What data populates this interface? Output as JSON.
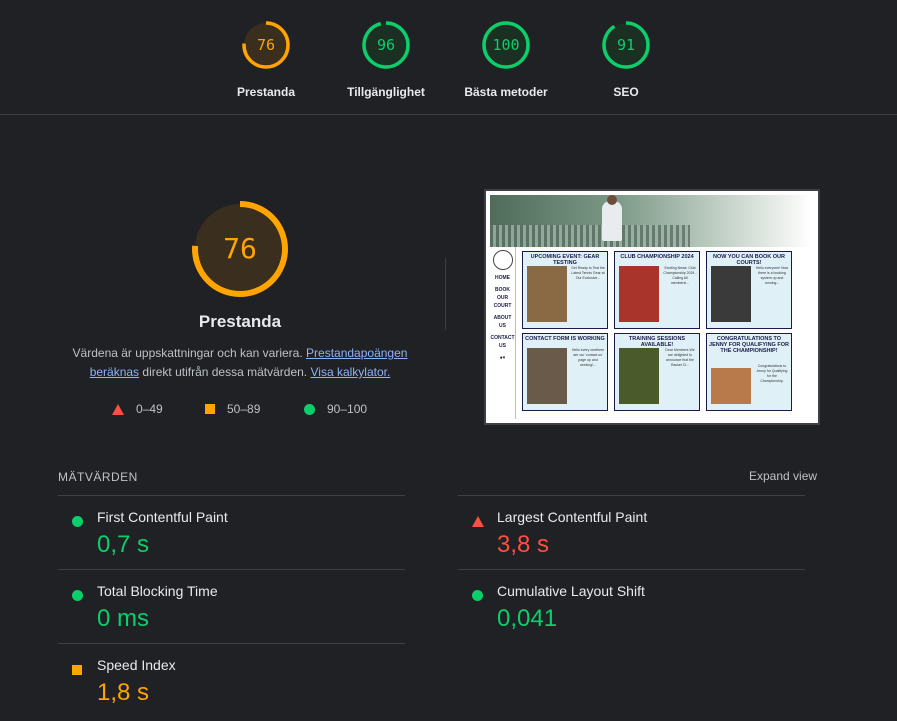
{
  "summary_gauges": [
    {
      "score": "76",
      "label": "Prestanda",
      "color": "#ffa400",
      "fraction": 0.76
    },
    {
      "score": "96",
      "label": "Tillgänglighet",
      "color": "#0cce6b",
      "fraction": 0.96
    },
    {
      "score": "100",
      "label": "Bästa metoder",
      "color": "#0cce6b",
      "fraction": 1.0
    },
    {
      "score": "91",
      "label": "SEO",
      "color": "#0cce6b",
      "fraction": 0.91
    }
  ],
  "main": {
    "score": "76",
    "score_fraction": 0.76,
    "title": "Prestanda",
    "desc_prefix": "Värdena är uppskattningar och kan variera. ",
    "desc_link1": "Prestandapoängen beräknas",
    "desc_middle": " direkt utifrån dessa mätvärden. ",
    "desc_link2": "Visa kalkylator.",
    "legend": [
      {
        "shape": "triangle",
        "range": "0–49",
        "color": "#ff4e42"
      },
      {
        "shape": "square",
        "range": "50–89",
        "color": "#ffa400"
      },
      {
        "shape": "circle",
        "range": "90–100",
        "color": "#0cce6b"
      }
    ]
  },
  "thumbnail": {
    "nav": [
      "HOME",
      "BOOK OUR COURT",
      "ABOUT US",
      "CONTACT US"
    ],
    "cards": [
      {
        "title": "UPCOMING EVENT: GEAR TESTING",
        "text": "Get Ready to Test the Latest Tennis Gear at Our Exclusive..."
      },
      {
        "title": "CLUB CHAMPIONSHIP 2024",
        "text": "Exciting News: Club Championship 2024 - Calling All members!..."
      },
      {
        "title": "NOW YOU CAN BOOK OUR COURTS!",
        "text": "Hello everyone! Now there is a booking system up and running..."
      },
      {
        "title": "CONTACT FORM IS WORKING",
        "text": "Hello every onethere are our 'contact us' page up and working!..."
      },
      {
        "title": "TRAINING SESSIONS AVAILABLE!",
        "text": "Dear Members We are delighted to announce that the Racket Cl..."
      },
      {
        "title": "CONGRATULATIONS TO JENNY FOR QUALIFYING FOR THE CHAMPIONSHIP!",
        "text": "Congratulations to Jenny for Qualifying for the Championship."
      }
    ]
  },
  "metrics": {
    "heading": "MÄTVÄRDEN",
    "expand_label": "Expand view",
    "items": [
      {
        "name": "First Contentful Paint",
        "value": "0,7 s",
        "status": "green"
      },
      {
        "name": "Largest Contentful Paint",
        "value": "3,8 s",
        "status": "red"
      },
      {
        "name": "Total Blocking Time",
        "value": "0 ms",
        "status": "green"
      },
      {
        "name": "Cumulative Layout Shift",
        "value": "0,041",
        "status": "green"
      },
      {
        "name": "Speed Index",
        "value": "1,8 s",
        "status": "orange"
      }
    ]
  }
}
